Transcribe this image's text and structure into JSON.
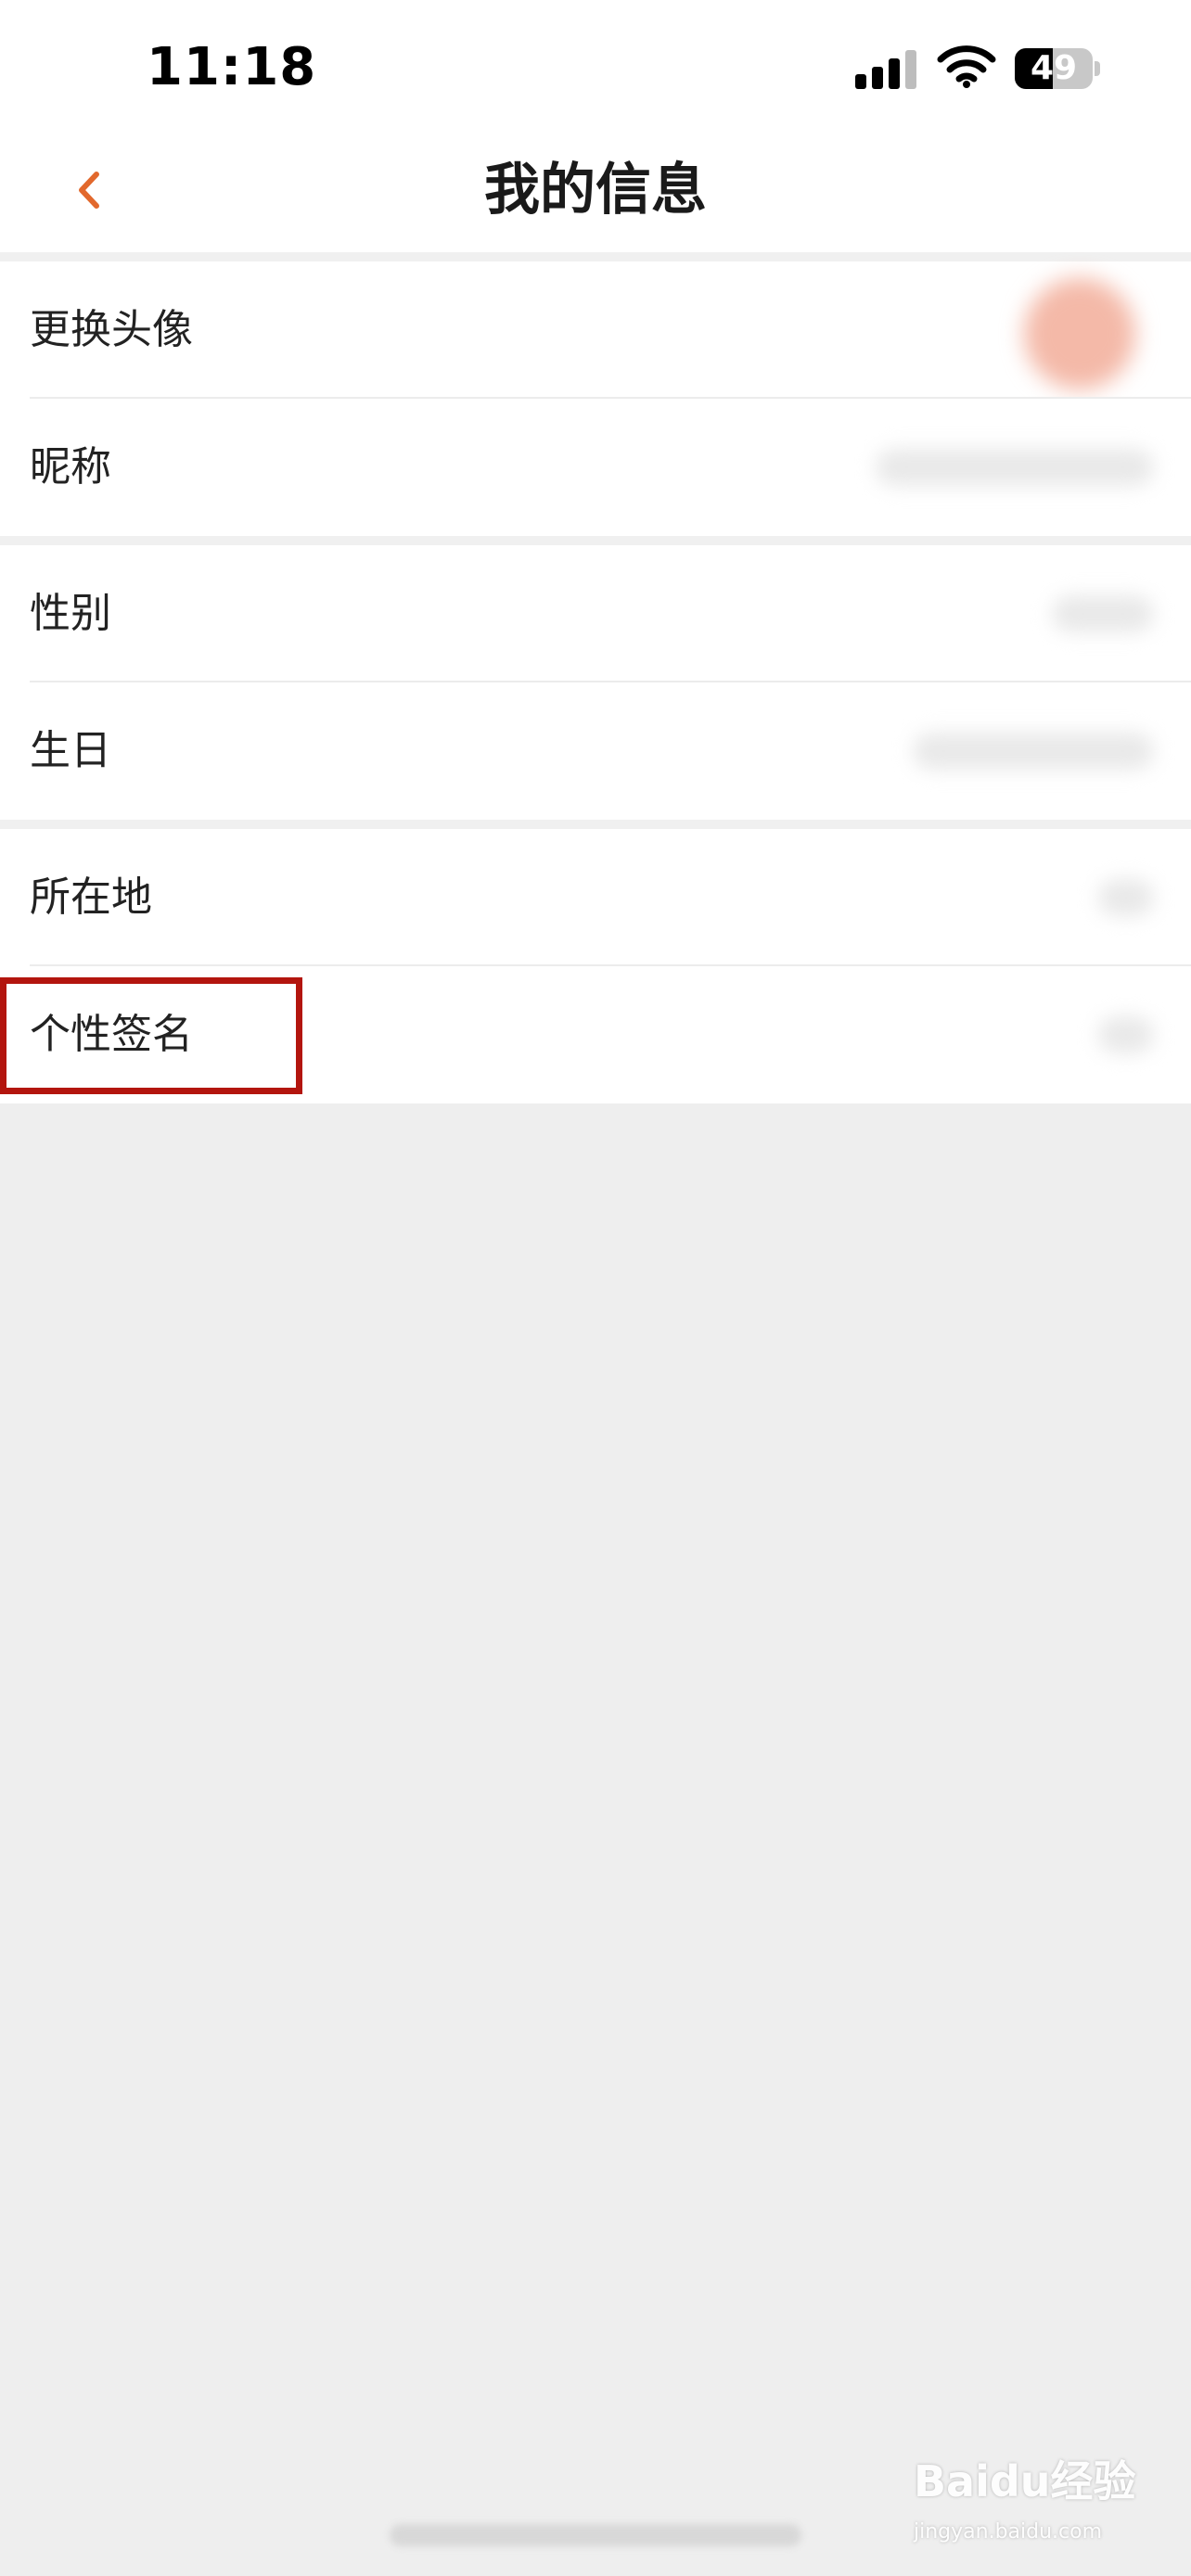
{
  "status_bar": {
    "time": "11:18",
    "battery_percent": 49,
    "battery_label": "49",
    "signal_icon": "cellular-signal-icon",
    "wifi_icon": "wifi-icon"
  },
  "header": {
    "title": "我的信息",
    "back_icon": "chevron-left-icon",
    "accent_color": "#e2682c"
  },
  "rows": [
    {
      "label": "更换头像",
      "value_blurred": true
    },
    {
      "label": "昵称",
      "value_blurred": true
    },
    {
      "label": "性别",
      "value_blurred": true
    },
    {
      "label": "生日",
      "value_blurred": true
    },
    {
      "label": "所在地",
      "value_blurred": true
    },
    {
      "label": "个性签名",
      "value_blurred": true
    }
  ],
  "highlight": {
    "target": "个性签名",
    "color": "#b3150e"
  },
  "watermark": {
    "main": "Baidu经验",
    "sub": "jingyan.baidu.com"
  }
}
